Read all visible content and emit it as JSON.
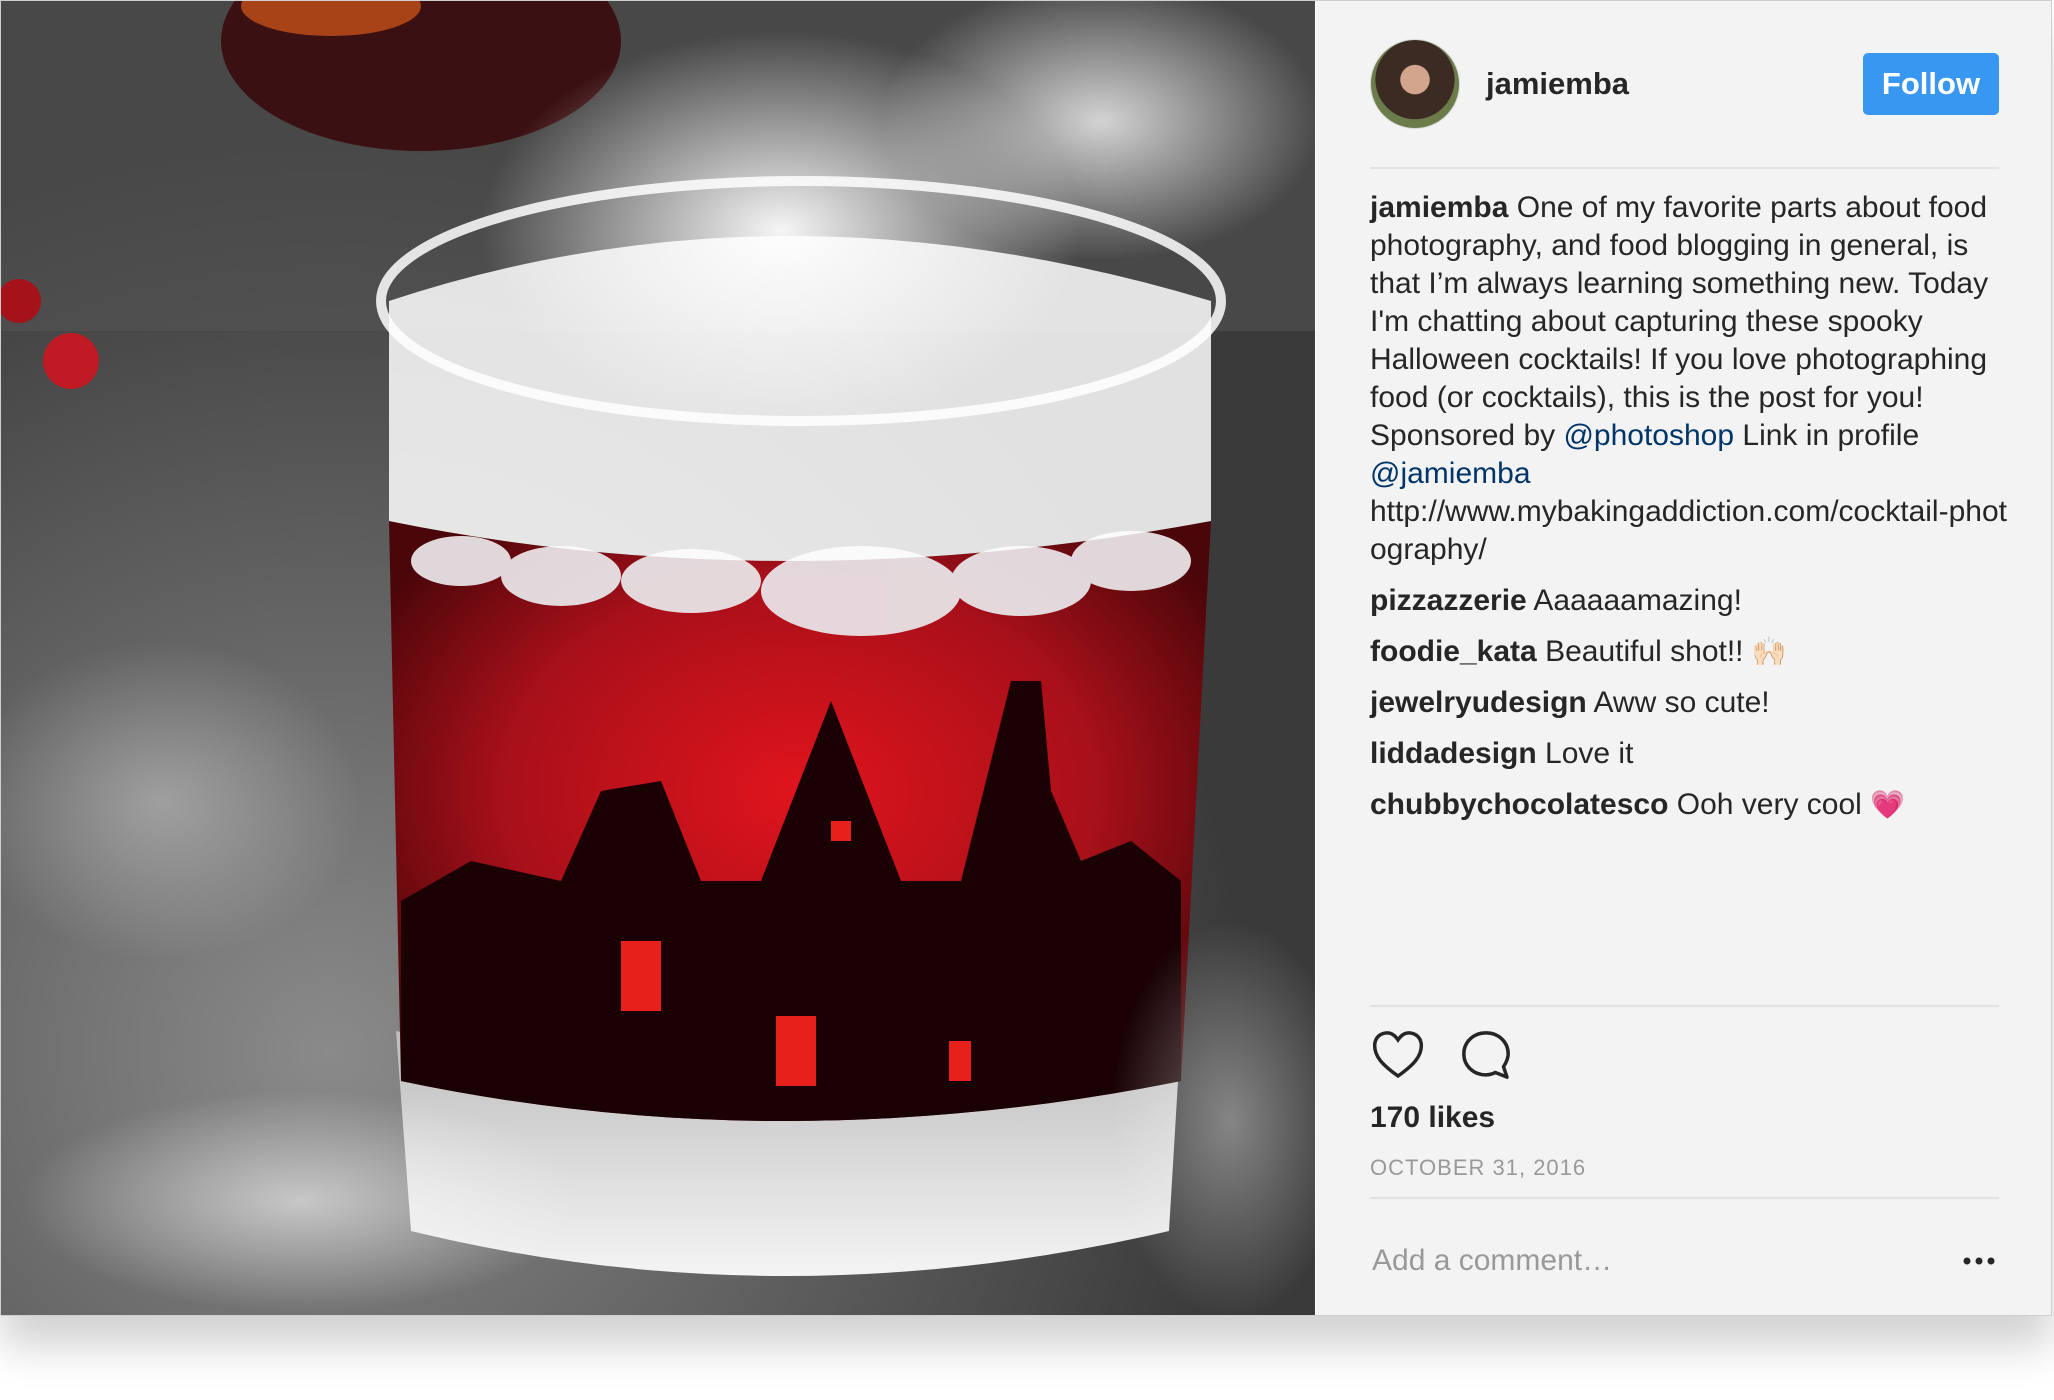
{
  "post": {
    "username": "jamiemba",
    "follow_label": "Follow",
    "caption": {
      "username": "jamiemba",
      "text_before_mention": " One of my favorite parts about food photography, and food blogging in general, is that I’m always learning something new. Today I'm chatting about capturing these spooky Halloween cocktails! If you love photographing food (or cocktails), this is the post for you! Sponsored by ",
      "mention_1": "@photoshop",
      "text_between": " Link in profile ",
      "mention_2": "@jamiemba",
      "url": "http://www.mybakingaddiction.com/cocktail-photography/"
    },
    "comments": [
      {
        "username": "pizzazzerie",
        "text": "Aaaaaamazing!",
        "emoji": ""
      },
      {
        "username": "foodie_kata",
        "text": "Beautiful shot!! ",
        "emoji": "🙌🏻"
      },
      {
        "username": "jewelryudesign",
        "text": "Aww so cute!",
        "emoji": ""
      },
      {
        "username": "liddadesign",
        "text": "Love it",
        "emoji": ""
      },
      {
        "username": "chubbychocolatesco",
        "text": "Ooh very cool ",
        "emoji": "💗"
      }
    ],
    "likes": "170 likes",
    "date": "OCTOBER 31, 2016",
    "comment_placeholder": "Add a comment…",
    "icons": {
      "like": "heart-icon",
      "comment": "speech-bubble-icon",
      "more": "more-options-icon"
    },
    "colors": {
      "follow_button": "#3897f0",
      "mention": "#003569",
      "drink": "#b0141a"
    }
  }
}
